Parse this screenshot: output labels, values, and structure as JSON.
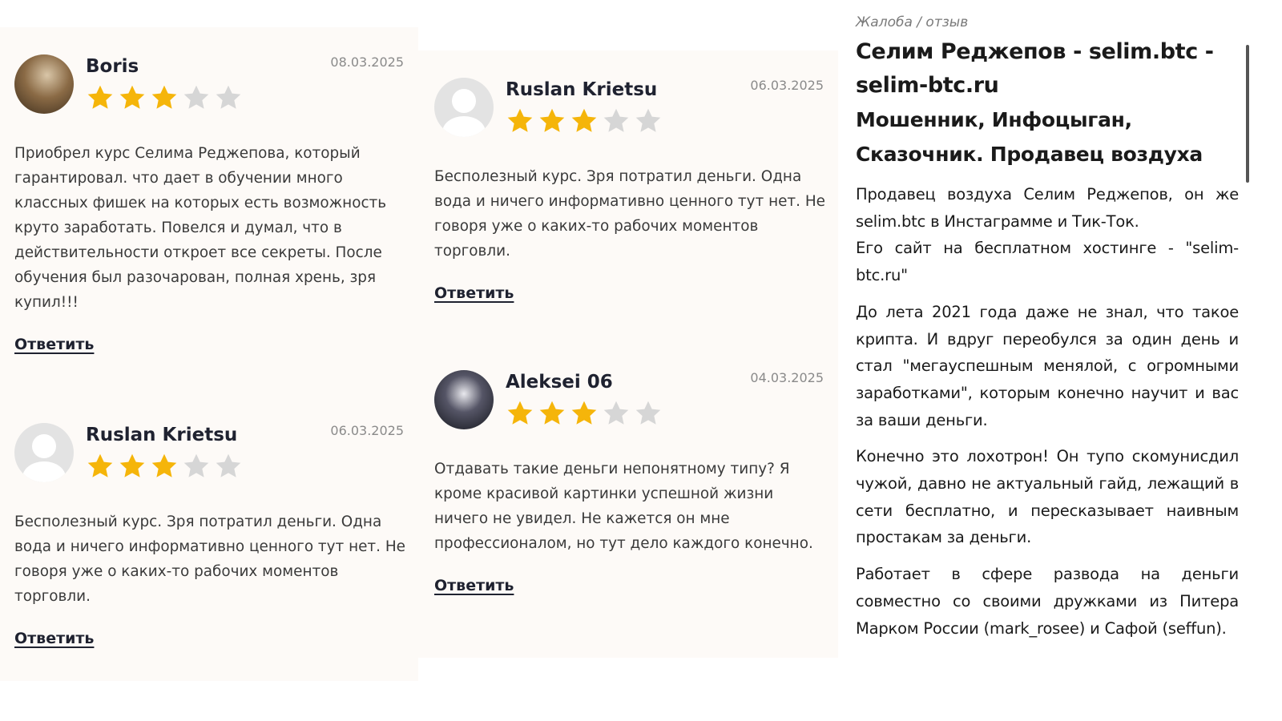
{
  "reviews_left": [
    {
      "name": "Boris",
      "date": "08.03.2025",
      "rating": 3,
      "max_rating": 5,
      "avatar": "photo",
      "text": "Приобрел курс Селима Реджепова, который гарантировал. что дает в обучении много классных фишек на которых есть возможность круто заработать. Повелся и думал, что в действительности откроет все секреты. После обучения был разочарован, полная хрень, зря купил!!!",
      "reply": "Ответить"
    },
    {
      "name": "Ruslan Krietsu",
      "date": "06.03.2025",
      "rating": 3,
      "max_rating": 5,
      "avatar": "placeholder",
      "text": "Бесполезный курс. Зря потратил деньги. Одна вода и ничего информативно ценного тут нет. Не говоря уже о каких-то рабочих моментов торговли.",
      "reply": "Ответить"
    }
  ],
  "reviews_right": [
    {
      "name": "Ruslan Krietsu",
      "date": "06.03.2025",
      "rating": 3,
      "max_rating": 5,
      "avatar": "placeholder",
      "text": "Бесполезный курс. Зря потратил деньги. Одна вода и ничего информативно ценного тут нет. Не говоря уже о каких-то рабочих моментов торговли.",
      "reply": "Ответить"
    },
    {
      "name": "Aleksei 06",
      "date": "04.03.2025",
      "rating": 3,
      "max_rating": 5,
      "avatar": "photo2",
      "text": "Отдавать такие деньги непонятному типу? Я кроме красивой картинки успешной жизни ничего не увидел. Не кажется он мне профессионалом, но тут дело каждого конечно.",
      "reply": "Ответить"
    }
  ],
  "article": {
    "breadcrumb": "Жалоба / отзыв",
    "title": "Селим Реджепов - selim.btc - selim-btc.ru",
    "subtitle": "Мошенник, Инфоцыган, Сказочник. Продавец воздуха",
    "p1_line1": "Продавец воздуха Селим Реджепов, он же selim.btc в Инстаграмме и Тик-Ток.",
    "p1_line2": "Его сайт на бесплатном хостинге - \"selim-btc.ru\"",
    "p2": "До лета 2021 года даже не знал, что такое крипта. И вдруг переобулся за один день и стал \"мегауспешным менялой, с огромными заработками\", которым конечно научит и вас за ваши деньги.",
    "p3": "Конечно это лохотрон! Он тупо скомунисдил чужой, давно не актуальный гайд, лежащий в сети бесплатно, и пересказывает наивным простакам за деньги.",
    "p4": "Работает в сфере развода на деньги совместно со своими дружками из Питера Марком России (mark_rosee) и Сафой (seffun)."
  },
  "colors": {
    "star_filled": "#f5b50a",
    "star_empty": "#d6d6d6",
    "panel_bg": "#fdfaf7"
  }
}
